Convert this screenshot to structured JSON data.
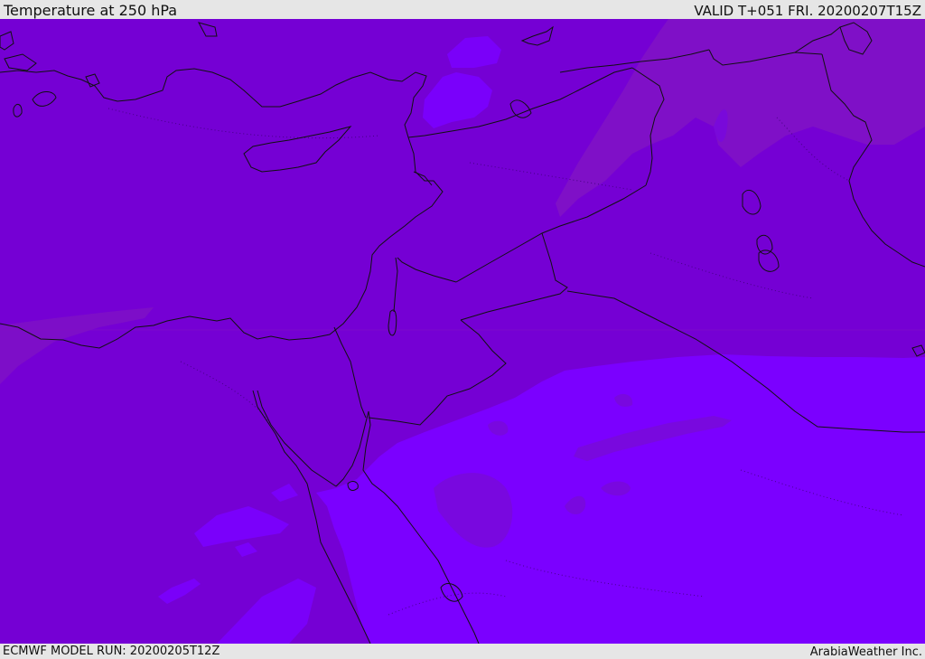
{
  "header": {
    "title": "Temperature at 250 hPa",
    "valid": "VALID T+051 FRI. 20200207T15Z"
  },
  "footer": {
    "model_run": "ECMWF MODEL RUN: 20200205T12Z",
    "credit": "ArabiaWeather Inc."
  },
  "map": {
    "field": "temperature-250hPa",
    "shade_colors": {
      "cold_dark": "#7500d4",
      "cold_mid": "#7909dc",
      "cold_warm_band": "#7f11c6",
      "coldest_bright": "#7b00ff",
      "outline": "#111111",
      "border_dash": "#333333"
    }
  }
}
